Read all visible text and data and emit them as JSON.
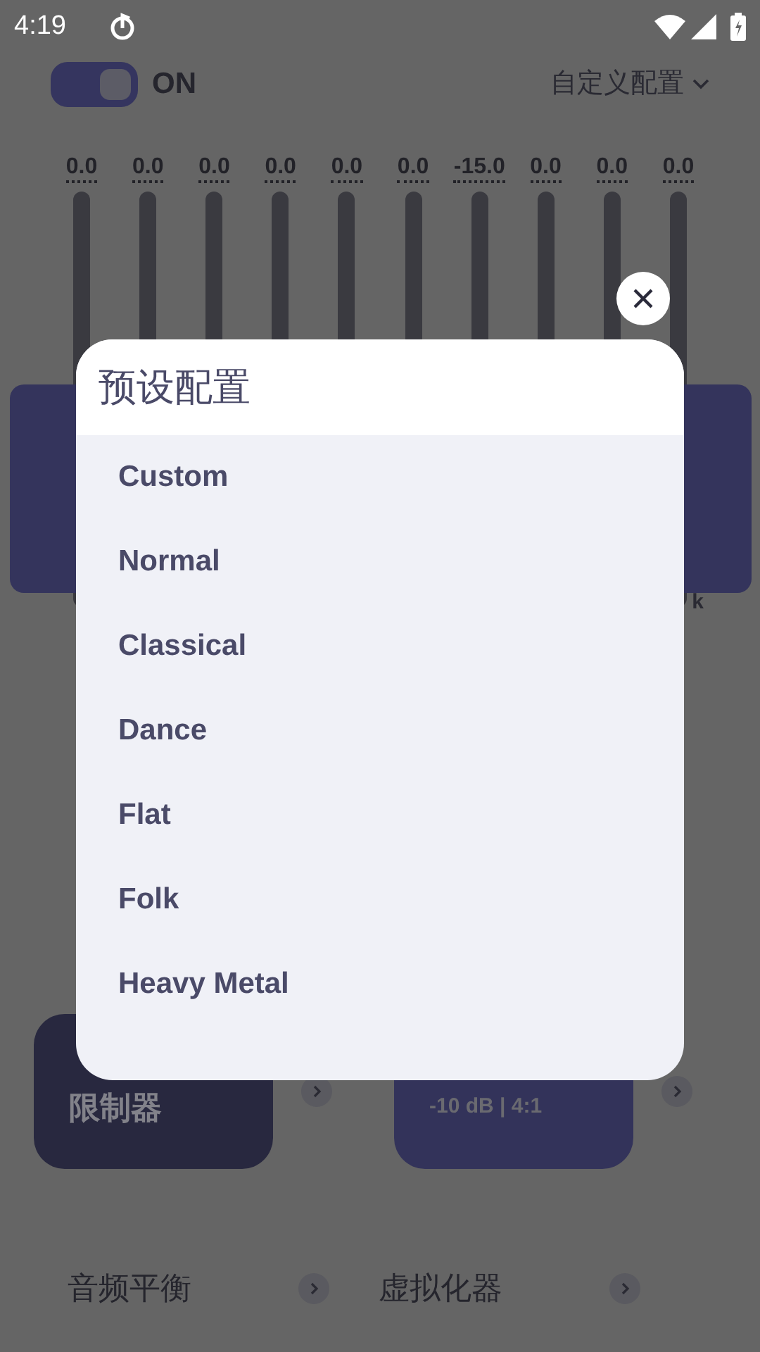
{
  "status_bar": {
    "time": "4:19"
  },
  "header": {
    "switch": {
      "on": true,
      "label": "ON"
    },
    "preset": "自定义配置"
  },
  "bands": [
    {
      "value": "0.0"
    },
    {
      "value": "0.0"
    },
    {
      "value": "0.0"
    },
    {
      "value": "0.0"
    },
    {
      "value": "0.0"
    },
    {
      "value": "0.0"
    },
    {
      "value": "-15.0"
    },
    {
      "value": "0.0"
    },
    {
      "value": "0.0"
    },
    {
      "value": "0.0"
    }
  ],
  "band_labels": [
    "k"
  ],
  "cards": [
    {
      "title": "限制器",
      "selected": false
    },
    {
      "subtitle": "-10 dB | 4:1",
      "selected": true
    }
  ],
  "rows": [
    {
      "title": "音频平衡"
    },
    {
      "title": "虚拟化器"
    }
  ],
  "dialog": {
    "title": "预设配置",
    "items": [
      {
        "label": "Custom"
      },
      {
        "label": "Normal"
      },
      {
        "label": "Classical"
      },
      {
        "label": "Dance"
      },
      {
        "label": "Flat"
      },
      {
        "label": "Folk"
      },
      {
        "label": "Heavy Metal"
      }
    ]
  }
}
